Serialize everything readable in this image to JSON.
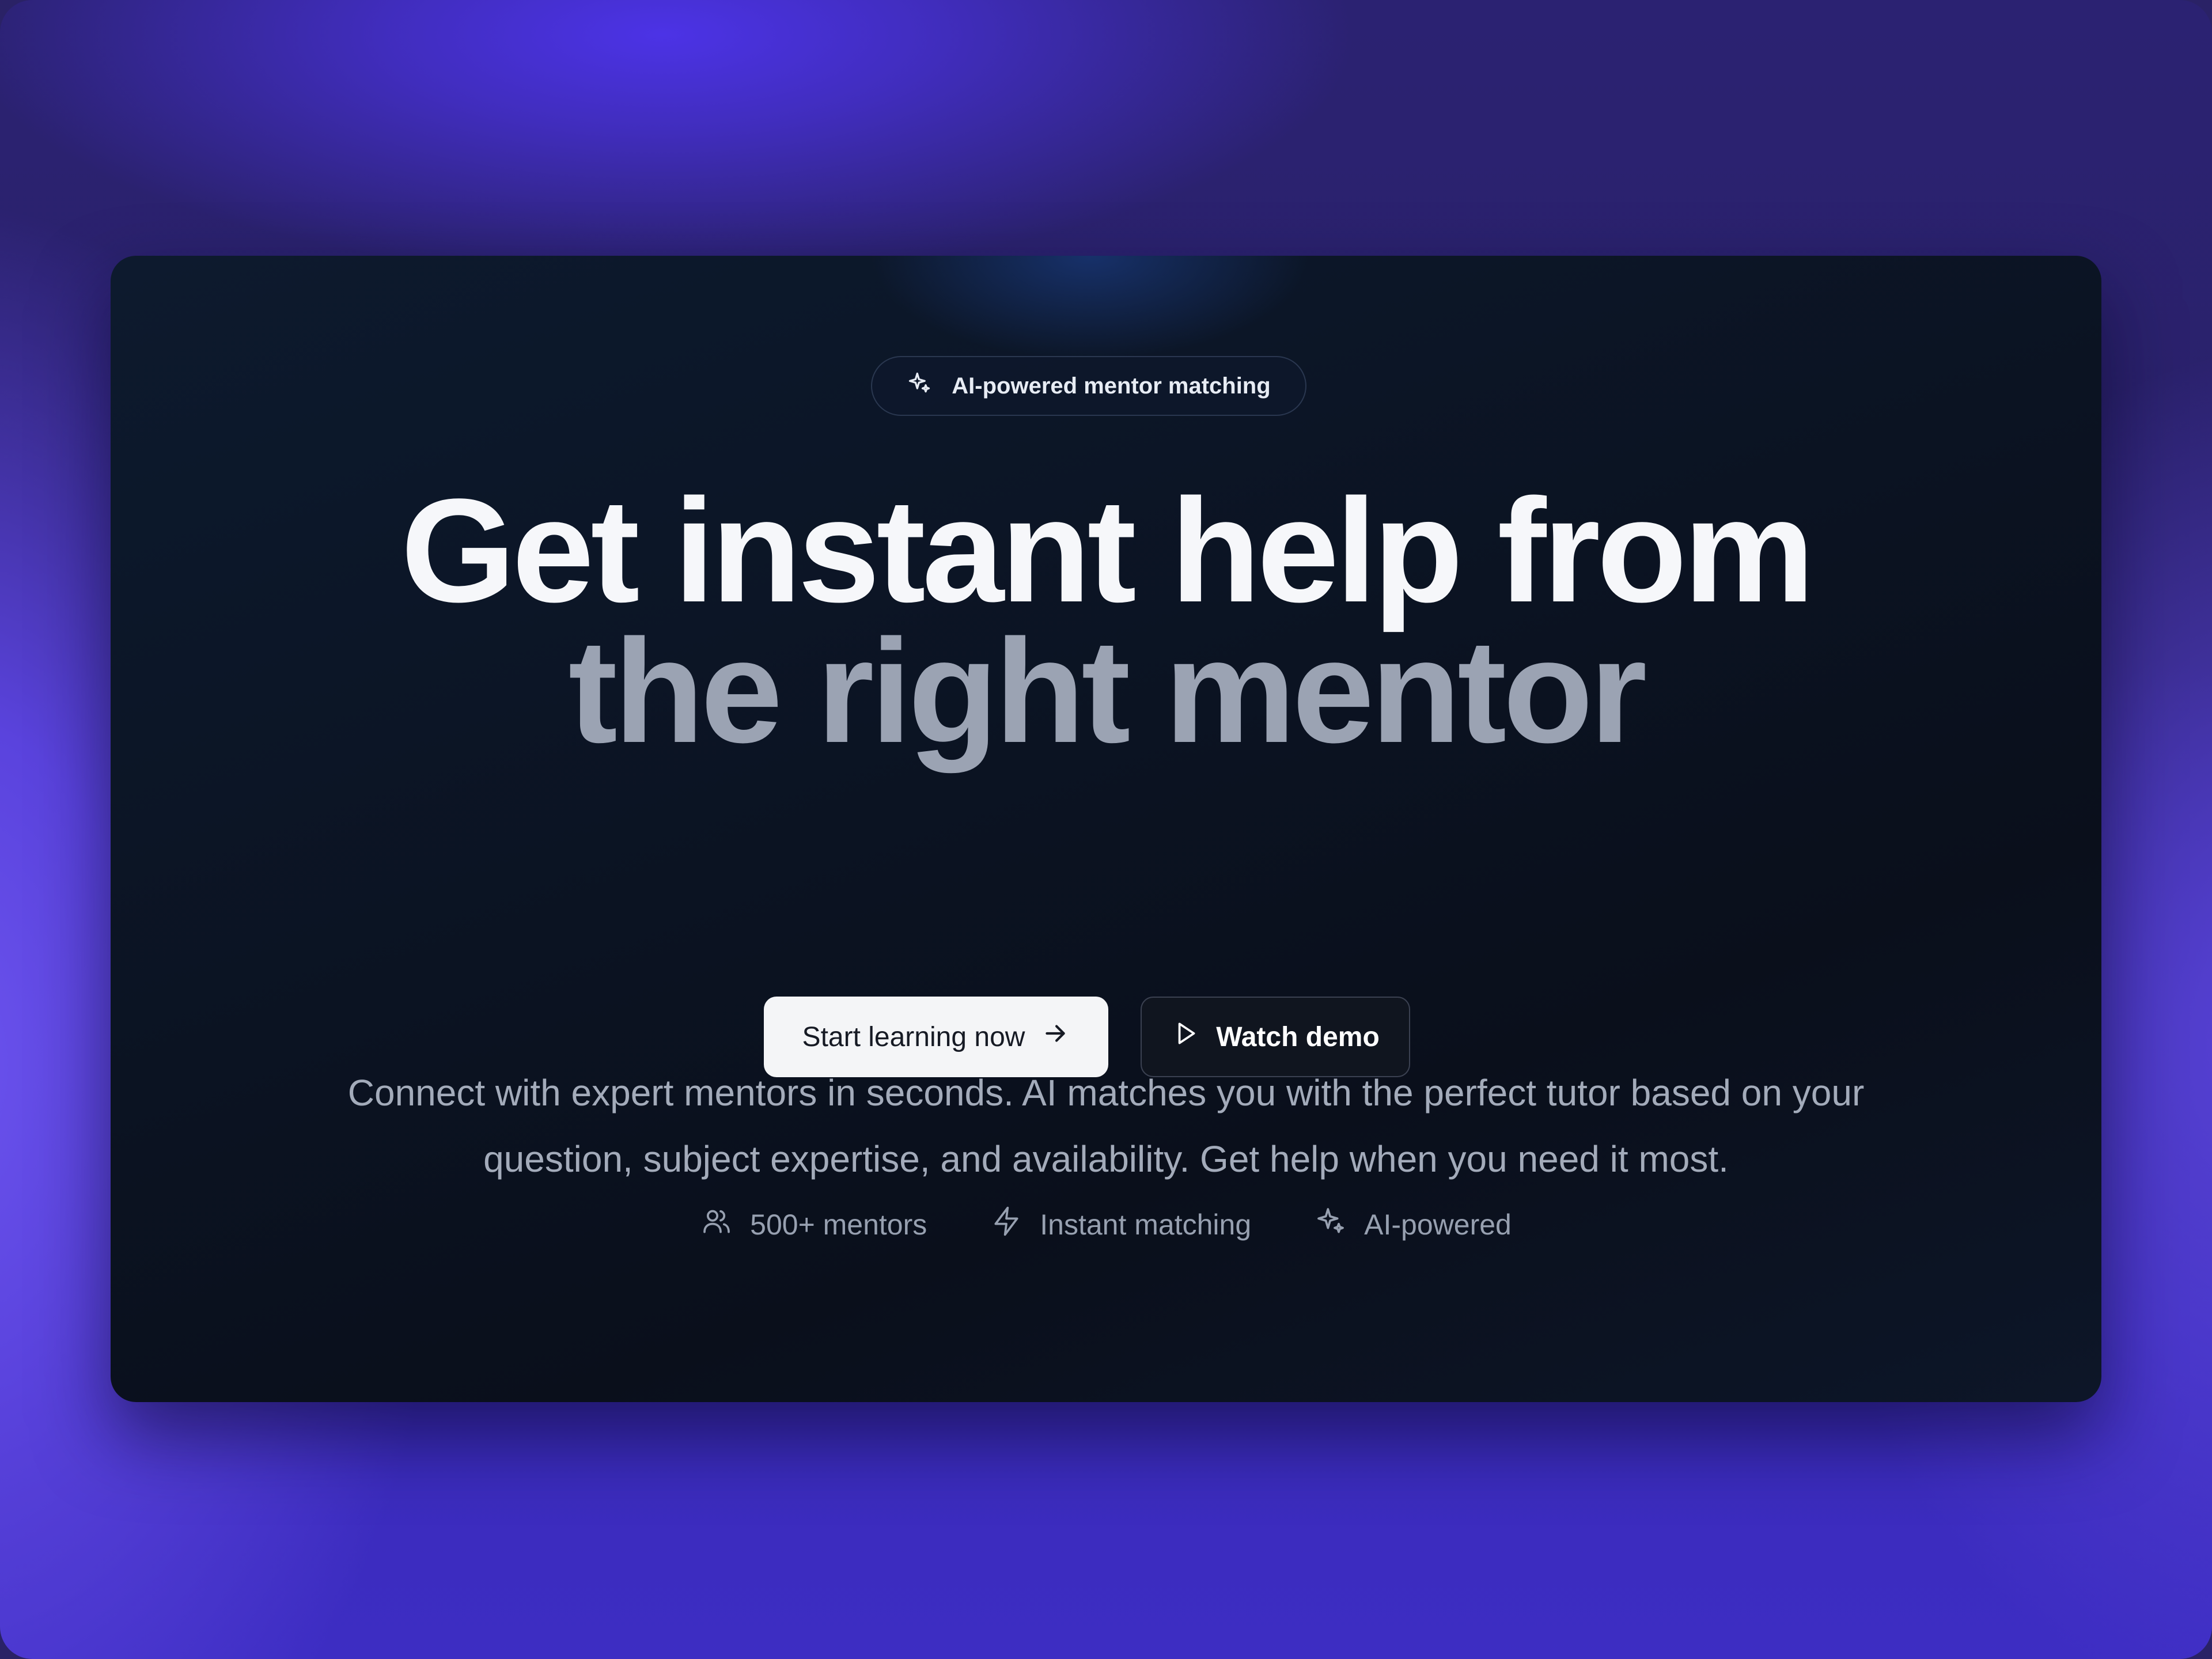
{
  "badge": {
    "icon": "sparkles-icon",
    "label": "AI-powered mentor matching"
  },
  "headline": {
    "line1": "Get instant help from",
    "line2": "the right mentor"
  },
  "subtitle": "Connect with expert mentors in seconds. AI matches you with the perfect tutor based on your question, subject expertise, and availability. Get help when you need it most.",
  "cta": {
    "primary_label": "Start learning now",
    "primary_icon": "arrow-right-icon",
    "secondary_label": "Watch demo",
    "secondary_icon": "play-icon"
  },
  "features": [
    {
      "icon": "users-icon",
      "label": "500+ mentors"
    },
    {
      "icon": "lightning-icon",
      "label": "Instant matching"
    },
    {
      "icon": "sparkles-icon",
      "label": "AI-powered"
    }
  ],
  "colors": {
    "background": "#2a2268",
    "accent_purple": "#4c33e6",
    "card": "#0b1322",
    "headline_primary": "#f6f7fa",
    "headline_secondary": "#9ba3b3"
  }
}
